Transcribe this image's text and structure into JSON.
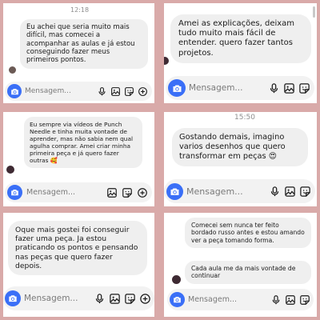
{
  "composer": {
    "placeholder": "Mensagem..."
  },
  "panels": [
    {
      "timestamp": "12:18",
      "messages": [
        "Eu achei que seria muito mais difícil, mas comecei a acompanhar as aulas e já estou conseguindo fazer meus primeiros pontos."
      ]
    },
    {
      "timestamp": "",
      "messages": [
        "Amei as explicações, deixam tudo muito mais fácil de entender. quero fazer tantos projetos."
      ]
    },
    {
      "timestamp": "",
      "messages": [
        "Eu sempre via vídeos de Punch Needle e tinha muita vontade de aprender, mas não sabia nem qual agulha comprar. Amei criar minha primeira peça e já quero fazer outras 🥰"
      ]
    },
    {
      "timestamp": "15:50",
      "messages": [
        "Gostando demais, imagino varios desenhos que quero transformar em peças 😍"
      ]
    },
    {
      "timestamp": "",
      "messages": [
        "Oque mais gostei foi conseguir fazer uma peça. Ja estou praticando os pontos e pensando nas peças que quero fazer depois."
      ]
    },
    {
      "timestamp": "",
      "messages": [
        "Comecei sem nunca ter feito bordado russo antes e estou amando ver a peça tomando forma.",
        "Cada aula me da mais vontade de continuar"
      ]
    }
  ],
  "colors": {
    "background": "#d9aaa9",
    "bubble": "#efefef",
    "camera_button": "#3a6ff7",
    "composer": "#f2f2f2"
  },
  "icons": [
    "camera-icon",
    "microphone-icon",
    "image-icon",
    "sticker-icon",
    "plus-icon"
  ]
}
